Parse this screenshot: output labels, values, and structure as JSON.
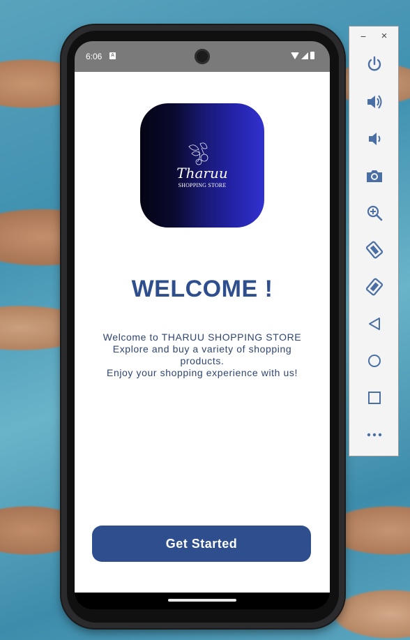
{
  "status_bar": {
    "time": "6:06",
    "notification_badge": "A"
  },
  "app": {
    "logo": {
      "name": "Tharuu",
      "subtitle": "SHOPPING STORE"
    },
    "welcome_title": "WELCOME !",
    "intro_lines": [
      "Welcome to THARUU SHOPPING STORE",
      "Explore and buy a variety of shopping",
      "products.",
      "Enjoy your shopping experience with us!"
    ],
    "cta_label": "Get Started"
  },
  "emulator_toolbar": {
    "minimize_label": "−",
    "close_label": "×",
    "buttons": [
      "power-icon",
      "volume-up-icon",
      "volume-down-icon",
      "camera-icon",
      "zoom-icon",
      "rotate-left-icon",
      "rotate-right-icon",
      "back-icon",
      "home-icon",
      "overview-icon",
      "more-icon"
    ]
  },
  "colors": {
    "accent": "#2e4e8e",
    "status_bar": "#7a7a7a",
    "toolbar_icon": "#4a6fa5"
  }
}
